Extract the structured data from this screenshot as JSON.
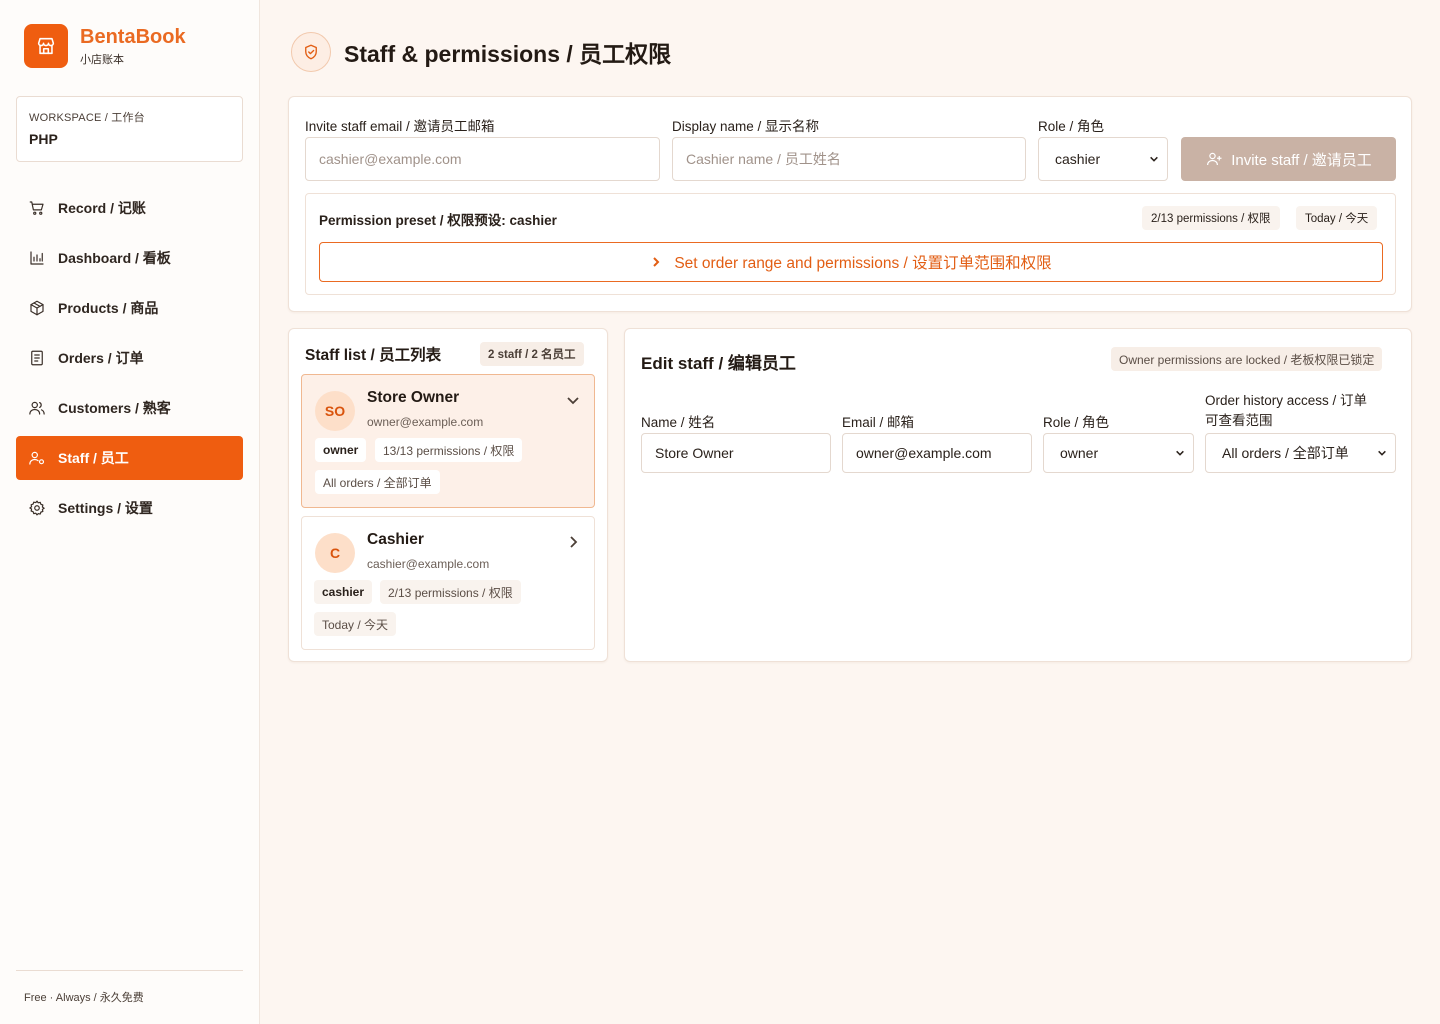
{
  "app": {
    "name": "BentaBook",
    "subtitle": "小店账本",
    "footer": "Free · Always / 永久免费"
  },
  "workspace": {
    "label": "WORKSPACE / 工作台",
    "value": "PHP"
  },
  "nav": [
    {
      "label": "Record / 记账",
      "icon": "cart-icon"
    },
    {
      "label": "Dashboard / 看板",
      "icon": "bar-chart-icon"
    },
    {
      "label": "Products / 商品",
      "icon": "box-icon"
    },
    {
      "label": "Orders / 订单",
      "icon": "receipt-icon"
    },
    {
      "label": "Customers / 熟客",
      "icon": "users-icon"
    },
    {
      "label": "Staff / 员工",
      "icon": "staff-icon",
      "active": true
    },
    {
      "label": "Settings / 设置",
      "icon": "gear-icon"
    }
  ],
  "page": {
    "title": "Staff & permissions / 员工权限"
  },
  "invite": {
    "email_label": "Invite staff email / 邀请员工邮箱",
    "email_placeholder": "cashier@example.com",
    "name_label": "Display name / 显示名称",
    "name_placeholder": "Cashier name / 员工姓名",
    "role_label": "Role / 角色",
    "role_value": "cashier",
    "button_label": "Invite staff / 邀请员工",
    "preset_title": "Permission preset / 权限预设: cashier",
    "preset_count": "2/13 permissions / 权限",
    "preset_date": "Today / 今天",
    "range_button": "Set order range and permissions / 设置订单范围和权限"
  },
  "staff_list": {
    "title": "Staff list / 员工列表",
    "count": "2 staff / 2 名员工",
    "items": [
      {
        "initials": "SO",
        "name": "Store Owner",
        "email": "owner@example.com",
        "role": "owner",
        "permissions": "13/13 permissions / 权限",
        "extra": "All orders / 全部订单"
      },
      {
        "initials": "C",
        "name": "Cashier",
        "email": "cashier@example.com",
        "role": "cashier",
        "permissions": "2/13 permissions / 权限",
        "extra": "Today / 今天"
      }
    ]
  },
  "edit": {
    "title": "Edit staff / 编辑员工",
    "locked": "Owner permissions are locked / 老板权限已锁定",
    "name_label": "Name / 姓名",
    "name_value": "Store Owner",
    "email_label": "Email / 邮箱",
    "email_value": "owner@example.com",
    "role_label": "Role / 角色",
    "role_value": "owner",
    "history_label_line1": "Order history access / 订单",
    "history_label_line2": "可查看范围",
    "history_value": "All orders / 全部订单"
  },
  "colors": {
    "accent": "#ef5d10",
    "accent_text": "#ea6a22",
    "disabled_button": "#c9b2a5",
    "background": "#fdf6f1"
  }
}
